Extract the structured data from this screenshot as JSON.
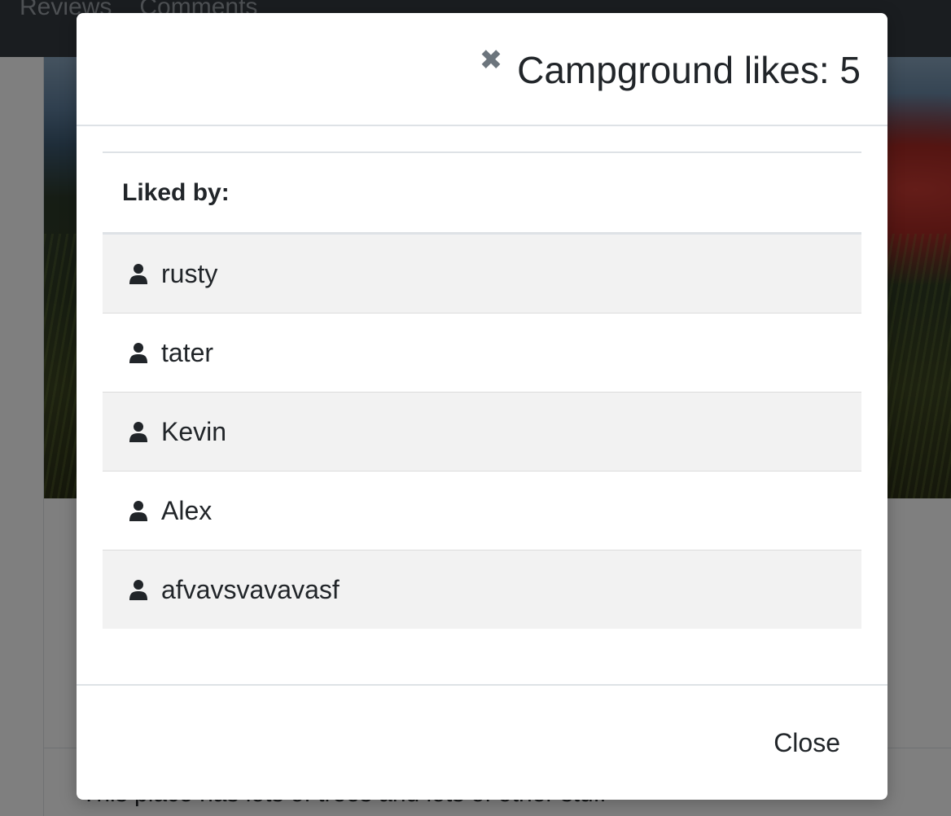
{
  "navbar": {
    "links": [
      "Reviews",
      "Comments"
    ]
  },
  "page": {
    "description": "This place has lots of trees and lots of other stuff"
  },
  "modal": {
    "title": "Campground likes: 5",
    "close_icon": "close-icon",
    "liked_by_label": "Liked by:",
    "users": [
      {
        "name": "rusty",
        "icon": "user-icon"
      },
      {
        "name": "tater",
        "icon": "user-icon"
      },
      {
        "name": "Kevin",
        "icon": "user-icon"
      },
      {
        "name": "Alex",
        "icon": "user-icon"
      },
      {
        "name": "afvavsvavavasf",
        "icon": "user-icon"
      }
    ],
    "close_label": "Close"
  },
  "colors": {
    "navbar": "#343a40",
    "stripe": "#f2f2f2",
    "backdrop": "rgba(0,0,0,0.5)"
  }
}
